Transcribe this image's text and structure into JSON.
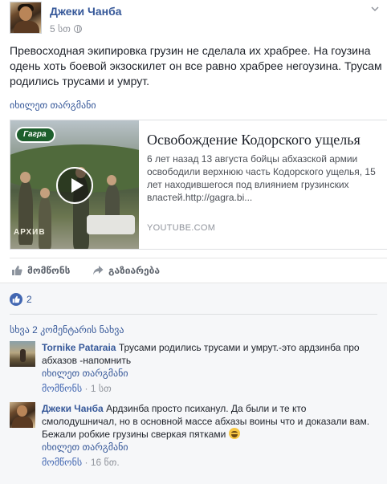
{
  "post": {
    "author": "Джеки Чанба",
    "time": "5 სთ",
    "text_lines": [
      "Превосходная экипировка грузин не сделала их храбрее. На гоузина",
      "одень хоть боевой экзоскилет он все равно храбрее негоузина. Трусам",
      "родились трусами и умрут."
    ],
    "see_translation": "იხილეთ თარგმანი"
  },
  "link_preview": {
    "title": "Освобождение Кодорского ущелья",
    "description_lines": [
      "6 лет назад 13 августа бойцы абхазской армии",
      "освободили верхнюю часть Кодорского ущелья, 15",
      "лет находившегося под влиянием грузинских",
      "властей.http://gagra.bi..."
    ],
    "domain": "YOUTUBE.COM",
    "thumb_logo": "Гагра",
    "thumb_watermark": "АРХИВ"
  },
  "actions": {
    "like_label": "მომწონს",
    "share_label": "გაზიარება"
  },
  "feedback": {
    "like_count": "2",
    "more_comments": "სხვა 2 კომენტარის ნახვა"
  },
  "comments": [
    {
      "author": "Tornike Pataraia",
      "lines": [
        "Трусами родились трусами и умрут.-это ардзинба про",
        "абхазов -напомнить"
      ],
      "see_translation": "იხილეთ თარგმანი",
      "like_label": "მომწონს",
      "time": "1 სთ"
    },
    {
      "author": "Джеки Чанба",
      "lines": [
        "Ардзинба просто психанул. Да были и те кто",
        "смолодушничал, но в основной массе абхазы воины что и доказали вам.",
        "Бежали робкие грузины сверкая пятками"
      ],
      "see_translation": "იხილეთ თარგმანი",
      "like_label": "მომწონს",
      "time": "16 წთ."
    }
  ],
  "colors": {
    "link": "#365899",
    "text": "#1d2129",
    "muted": "#90949c",
    "like_blue": "#4267b2",
    "feedback_bg": "#f6f7f9"
  },
  "icons": [
    "globe-icon",
    "chevron-down-icon",
    "play-icon",
    "like-icon",
    "share-icon",
    "like-reaction-icon",
    "grinning-emoji-icon"
  ]
}
